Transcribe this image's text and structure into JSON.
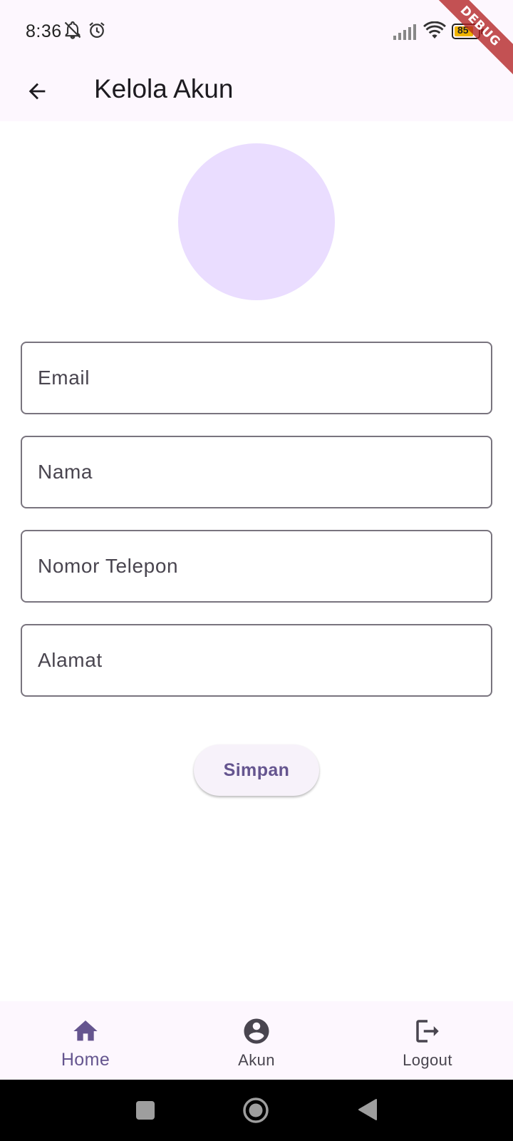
{
  "status_bar": {
    "time": "8:36",
    "battery_level": "85",
    "icons": [
      "notifications-off-icon",
      "alarm-icon",
      "cellular-signal-icon",
      "wifi-icon",
      "battery-icon"
    ]
  },
  "debug_banner": "DEBUG",
  "app_bar": {
    "title": "Kelola Akun",
    "back_icon": "arrow-back-icon"
  },
  "avatar": {
    "color": "#eaddff"
  },
  "form": {
    "email_placeholder": "Email",
    "name_placeholder": "Nama",
    "phone_placeholder": "Nomor Telepon",
    "address_placeholder": "Alamat",
    "save_label": "Simpan"
  },
  "bottom_nav": {
    "items": [
      {
        "label": "Home",
        "icon": "home-icon",
        "active": true
      },
      {
        "label": "Akun",
        "icon": "account-circle-icon",
        "active": false
      },
      {
        "label": "Logout",
        "icon": "logout-icon",
        "active": false
      }
    ]
  },
  "system_nav": {
    "icons": [
      "recents-icon",
      "home-circle-icon",
      "back-triangle-icon"
    ]
  },
  "colors": {
    "primary": "#65558f",
    "surface": "#fdf7fe",
    "outline": "#79747e",
    "avatar": "#eaddff",
    "debug": "#b22222"
  }
}
